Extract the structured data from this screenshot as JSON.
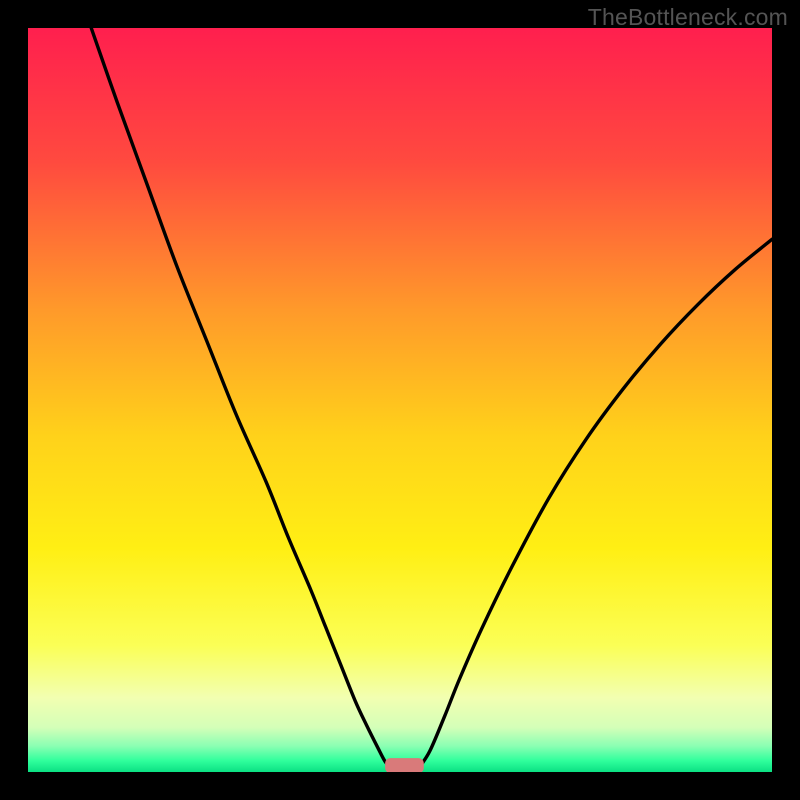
{
  "watermark": "TheBottleneck.com",
  "chart_data": {
    "type": "line",
    "title": "",
    "xlabel": "",
    "ylabel": "",
    "xlim": [
      0,
      100
    ],
    "ylim": [
      0,
      100
    ],
    "grid": false,
    "legend": false,
    "background_gradient_stops": [
      {
        "offset": 0.0,
        "color": "#ff1f4e"
      },
      {
        "offset": 0.18,
        "color": "#ff4a3f"
      },
      {
        "offset": 0.38,
        "color": "#ff9a2a"
      },
      {
        "offset": 0.55,
        "color": "#ffd21a"
      },
      {
        "offset": 0.7,
        "color": "#ffef14"
      },
      {
        "offset": 0.83,
        "color": "#fbff56"
      },
      {
        "offset": 0.9,
        "color": "#f2ffb1"
      },
      {
        "offset": 0.94,
        "color": "#d4ffb8"
      },
      {
        "offset": 0.965,
        "color": "#8bffb3"
      },
      {
        "offset": 0.985,
        "color": "#2fff9c"
      },
      {
        "offset": 1.0,
        "color": "#0be083"
      }
    ],
    "series": [
      {
        "name": "left-curve",
        "x": [
          8.5,
          12,
          16,
          20,
          24,
          28,
          32,
          35,
          38,
          40,
          42,
          44,
          45.5,
          47,
          48,
          48.8
        ],
        "y": [
          100,
          90,
          79,
          68,
          58,
          48,
          39,
          31.5,
          24.5,
          19.5,
          14.5,
          9.5,
          6.3,
          3.3,
          1.4,
          0.5
        ]
      },
      {
        "name": "right-curve",
        "x": [
          52.5,
          54,
          56,
          58,
          61,
          65,
          70,
          75,
          80,
          85,
          90,
          95,
          100
        ],
        "y": [
          0.5,
          2.8,
          7.5,
          12.5,
          19.3,
          27.5,
          36.8,
          44.7,
          51.5,
          57.5,
          62.8,
          67.5,
          71.6
        ]
      }
    ],
    "marker": {
      "name": "bottleneck-marker",
      "x_center": 50.6,
      "width": 5.2,
      "height": 2.0,
      "color": "#d97a7a",
      "radius": 5
    }
  }
}
